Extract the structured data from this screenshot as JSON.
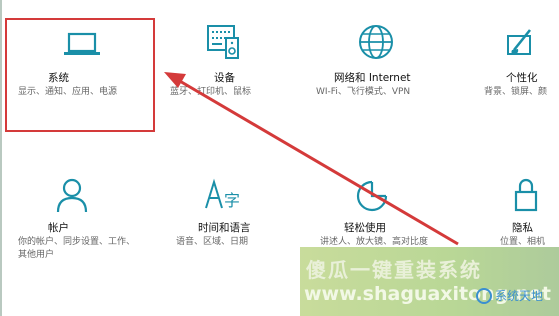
{
  "tiles": [
    {
      "title": "系统",
      "desc": "显示、通知、应用、电源",
      "icon": "laptop-icon"
    },
    {
      "title": "设备",
      "desc": "蓝牙、打印机、鼠标",
      "icon": "keyboard-speaker-icon"
    },
    {
      "title": "网络和 Internet",
      "desc": "WI-Fi、飞行模式、VPN",
      "icon": "globe-icon"
    },
    {
      "title": "个性化",
      "desc": "背景、锁屏、颜",
      "icon": "paint-brush-icon"
    },
    {
      "title": "帐户",
      "desc": "你的帐户、同步设置、工作、其他用户",
      "icon": "person-icon"
    },
    {
      "title": "时间和语言",
      "desc": "语音、区域、日期",
      "icon": "time-language-icon"
    },
    {
      "title": "轻松使用",
      "desc": "讲述人、放大镜、高对比度",
      "icon": "ease-of-access-icon"
    },
    {
      "title": "隐私",
      "desc": "位置、相机",
      "icon": "lock-icon"
    }
  ],
  "watermark": {
    "cn": "傻瓜一键重装系统",
    "url": "www.shaguaxitong.net",
    "logo": "系统天地"
  },
  "colors": {
    "accent": "#1a8fa8",
    "highlight": "#d43a3a"
  }
}
